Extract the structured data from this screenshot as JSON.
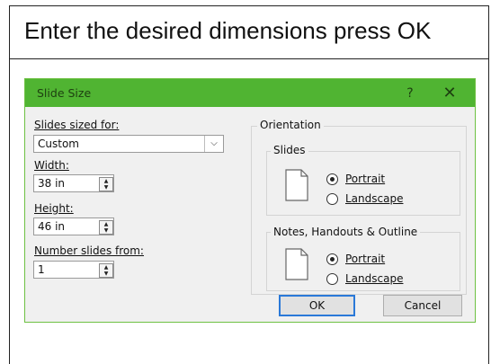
{
  "instruction": "Enter the desired dimensions press OK",
  "dialog": {
    "title": "Slide Size",
    "help": "?",
    "close": "✕",
    "slides_sized_for": {
      "label": "Slides sized for:",
      "value": "Custom"
    },
    "width": {
      "label": "Width:",
      "value": "38 in"
    },
    "height": {
      "label": "Height:",
      "value": "46 in"
    },
    "number_from": {
      "label": "Number slides from:",
      "value": "1"
    },
    "orientation": {
      "label": "Orientation",
      "slides": {
        "label": "Slides",
        "portrait": "Portrait",
        "landscape": "Landscape",
        "selected": "Portrait"
      },
      "notes": {
        "label": "Notes, Handouts & Outline",
        "portrait": "Portrait",
        "landscape": "Landscape",
        "selected": "Portrait"
      }
    },
    "ok": "OK",
    "cancel": "Cancel"
  }
}
